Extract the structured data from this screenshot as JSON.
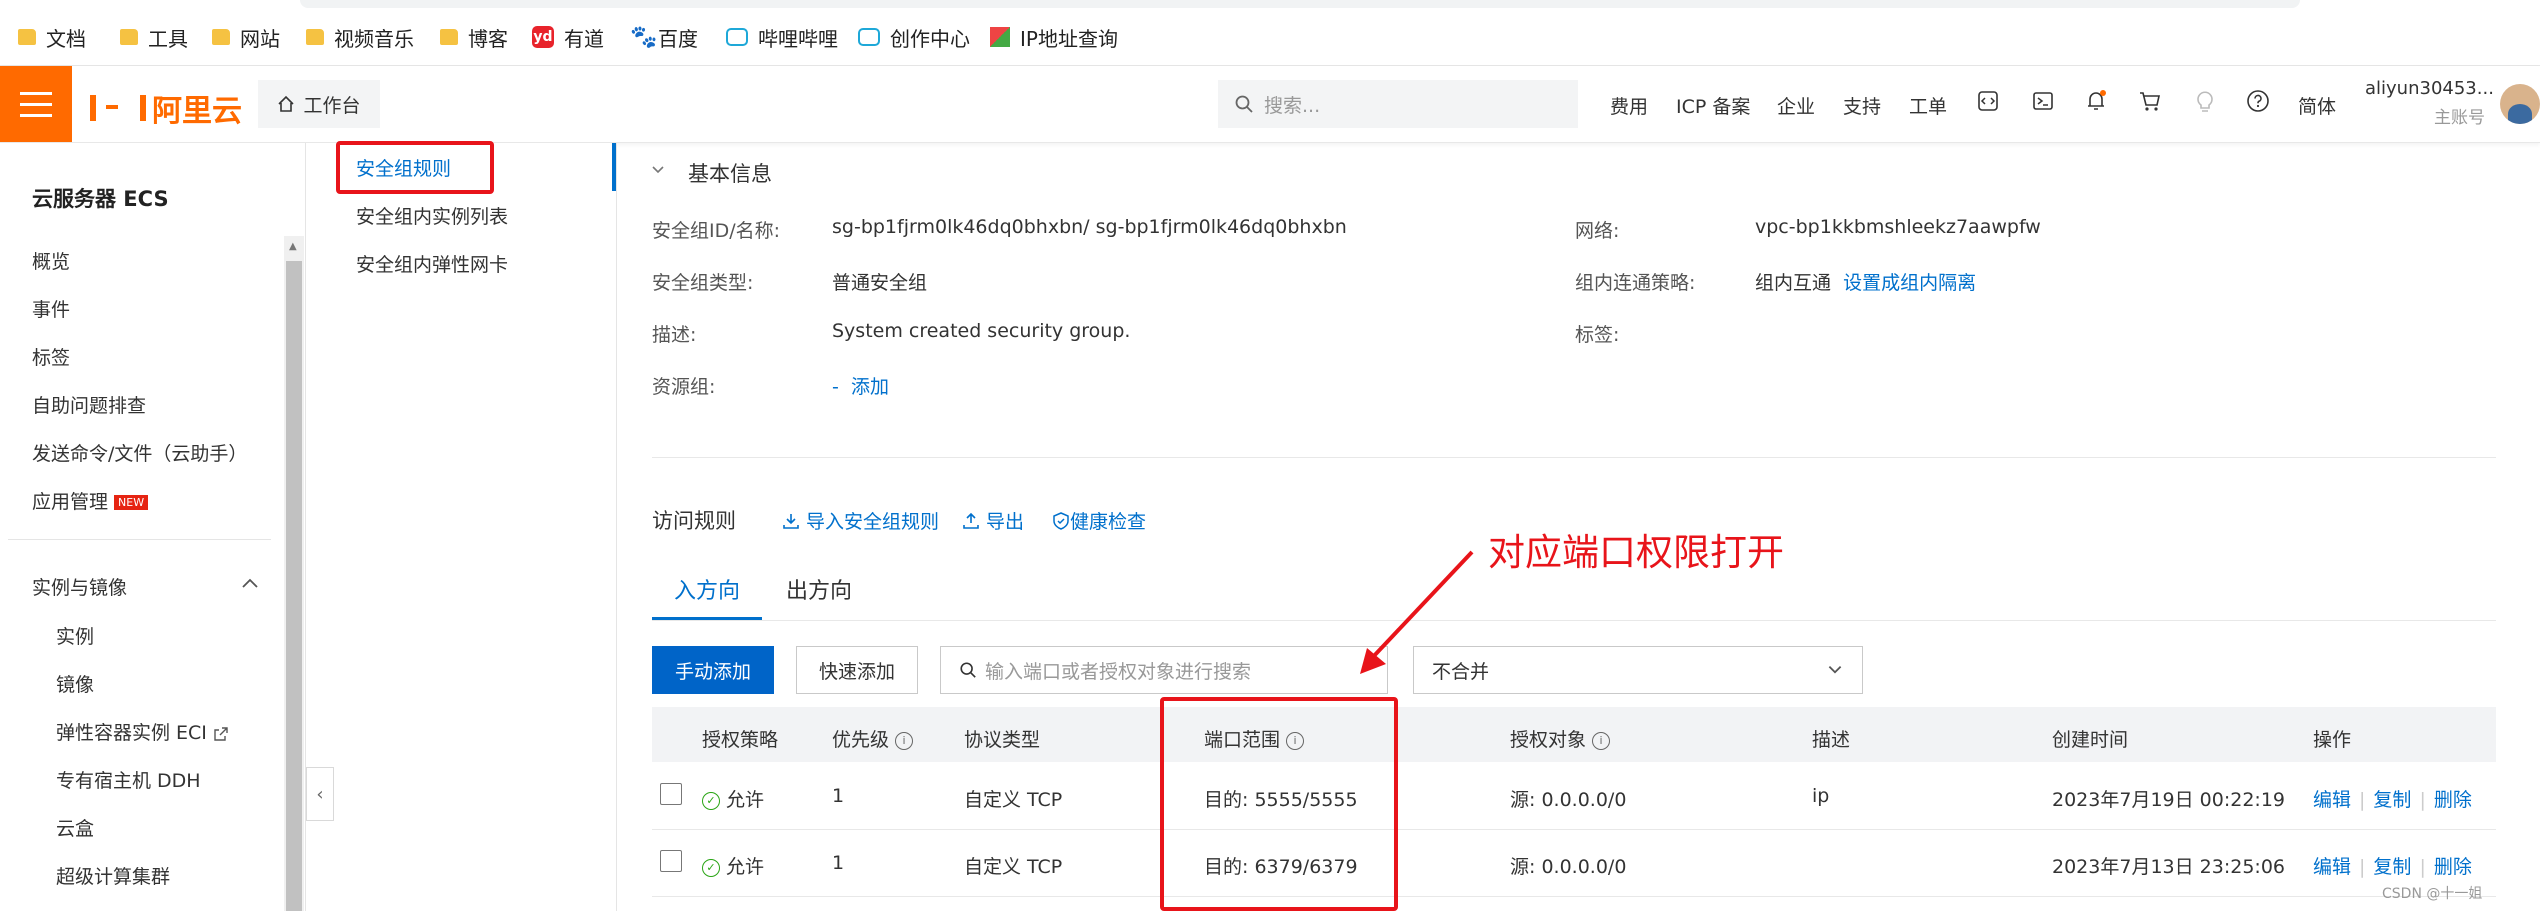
{
  "bookmarks": [
    {
      "label": "文档",
      "icon": "folder-icon"
    },
    {
      "label": "工具",
      "icon": "folder-icon"
    },
    {
      "label": "网站",
      "icon": "folder-icon"
    },
    {
      "label": "视频音乐",
      "icon": "folder-icon"
    },
    {
      "label": "博客",
      "icon": "folder-icon"
    },
    {
      "label": "有道",
      "icon": "youdao-icon",
      "glyph": "yd"
    },
    {
      "label": "百度",
      "icon": "baidu-icon",
      "glyph": "🐾"
    },
    {
      "label": "哔哩哔哩",
      "icon": "bilibili-icon"
    },
    {
      "label": "创作中心",
      "icon": "bilibili-icon"
    },
    {
      "label": "IP地址查询",
      "icon": "ip-icon"
    }
  ],
  "topnav": {
    "logo_text": "阿里云",
    "workbench": "工作台",
    "search_placeholder": "搜索...",
    "links": [
      "费用",
      "ICP 备案",
      "企业",
      "支持",
      "工单"
    ],
    "lang": "简体",
    "user_name": "aliyun30453...",
    "user_role": "主账号",
    "accent": "#ff6a00"
  },
  "sidebar": {
    "title": "云服务器 ECS",
    "items": [
      "概览",
      "事件",
      "标签",
      "自助问题排查",
      "发送命令/文件（云助手）",
      "应用管理"
    ],
    "new_badge": "NEW",
    "group_title": "实例与镜像",
    "group_items": [
      "实例",
      "镜像",
      "弹性容器实例 ECI",
      "专有宿主机 DDH",
      "云盒",
      "超级计算集群"
    ]
  },
  "subnav": {
    "items": [
      "安全组规则",
      "安全组内实例列表",
      "安全组内弹性网卡"
    ]
  },
  "basic_info": {
    "section_title": "基本信息",
    "fields": {
      "id_label": "安全组ID/名称:",
      "id_value": "sg-bp1fjrm0lk46dq0bhxbn/ sg-bp1fjrm0lk46dq0bhxbn",
      "type_label": "安全组类型:",
      "type_value": "普通安全组",
      "desc_label": "描述:",
      "desc_value": "System created security group.",
      "rg_label": "资源组:",
      "rg_dash": "-",
      "rg_add": "添加",
      "net_label": "网络:",
      "net_value": "vpc-bp1kkbmshleekz7aawpfw",
      "policy_label": "组内连通策略:",
      "policy_value": "组内互通",
      "policy_link": "设置成组内隔离",
      "tag_label": "标签:"
    }
  },
  "rules": {
    "section_title": "访问规则",
    "actions": [
      "导入安全组规则",
      "导出",
      "健康检查"
    ],
    "tabs": [
      "入方向",
      "出方向"
    ],
    "btn_manual": "手动添加",
    "btn_quick": "快速添加",
    "search_placeholder": "输入端口或者授权对象进行搜索",
    "merge_value": "不合并",
    "columns": [
      "授权策略",
      "优先级",
      "协议类型",
      "端口范围",
      "授权对象",
      "描述",
      "创建时间",
      "操作"
    ],
    "rows": [
      {
        "policy": "允许",
        "priority": "1",
        "protocol": "自定义 TCP",
        "port": "目的: 5555/5555",
        "source": "源: 0.0.0.0/0",
        "desc": "ip",
        "created": "2023年7月19日 00:22:19",
        "ops": [
          "编辑",
          "复制",
          "删除"
        ]
      },
      {
        "policy": "允许",
        "priority": "1",
        "protocol": "自定义 TCP",
        "port": "目的: 6379/6379",
        "source": "源: 0.0.0.0/0",
        "desc": "",
        "created": "2023年7月13日 23:25:06",
        "ops": [
          "编辑",
          "复制",
          "删除"
        ]
      }
    ]
  },
  "annotation": {
    "text": "对应端口权限打开",
    "color": "#e8141a"
  },
  "watermark": "CSDN @十一姐"
}
